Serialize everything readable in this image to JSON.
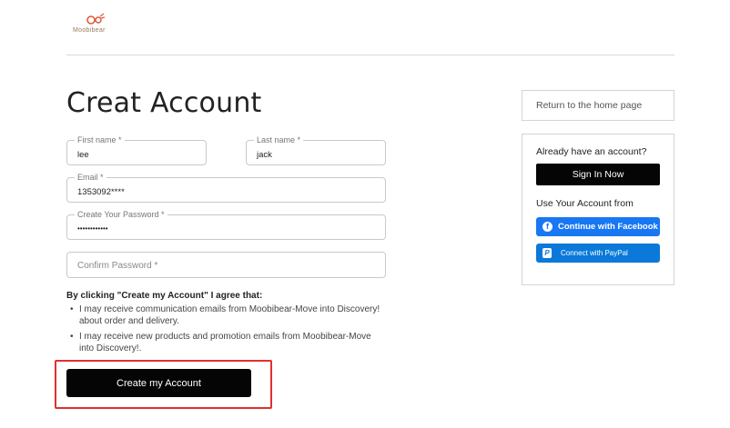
{
  "brand": {
    "name": "Moobibear"
  },
  "page": {
    "title": "Creat Account"
  },
  "form": {
    "first_name": {
      "label": "First name *",
      "value": "lee"
    },
    "last_name": {
      "label": "Last name *",
      "value": "jack"
    },
    "email": {
      "label": "Email *",
      "value": "1353092****"
    },
    "password": {
      "label": "Create Your Password *",
      "value": "••••••••••••"
    },
    "confirm_password": {
      "placeholder": "Confirm Password *"
    }
  },
  "agreement": {
    "title": "By clicking \"Create my Account\" I agree that:",
    "items": [
      "I may receive communication emails from Moobibear-Move into Discovery! about order and delivery.",
      "I may receive new products and promotion emails from Moobibear-Move into Discovery!."
    ]
  },
  "create_button": {
    "label": "Create my Account"
  },
  "sidebar": {
    "home_link": "Return to the home page",
    "have_account": "Already have an account?",
    "signin_label": "Sign In Now",
    "use_account_from": "Use Your Account from",
    "facebook_label": "Continue with Facebook",
    "paypal_label": "Connect with PayPal"
  },
  "colors": {
    "facebook": "#1877f2",
    "paypal": "#0a79d9",
    "primary_button": "#050505",
    "highlight": "#e0302f"
  }
}
